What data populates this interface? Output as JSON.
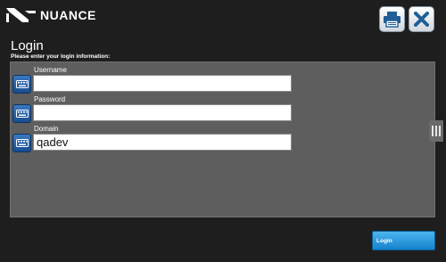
{
  "brand": {
    "name": "NUANCE",
    "color": "#ffffff"
  },
  "header": {
    "printer_icon": "printer-icon",
    "close_icon": "close-icon"
  },
  "login": {
    "title": "Login",
    "subtitle": "Please enter your login information:",
    "fields": [
      {
        "label": "Username",
        "value": "",
        "icon": "keyboard-icon"
      },
      {
        "label": "Password",
        "value": "",
        "icon": "keyboard-icon"
      },
      {
        "label": "Domain",
        "value": "qadev",
        "icon": "keyboard-icon"
      }
    ],
    "submit_label": "Login"
  },
  "colors": {
    "background": "#1e1e1e",
    "panel": "#5e5e5e",
    "accent": "#1f8fd8",
    "keyboard_button": "#2a62a8"
  }
}
